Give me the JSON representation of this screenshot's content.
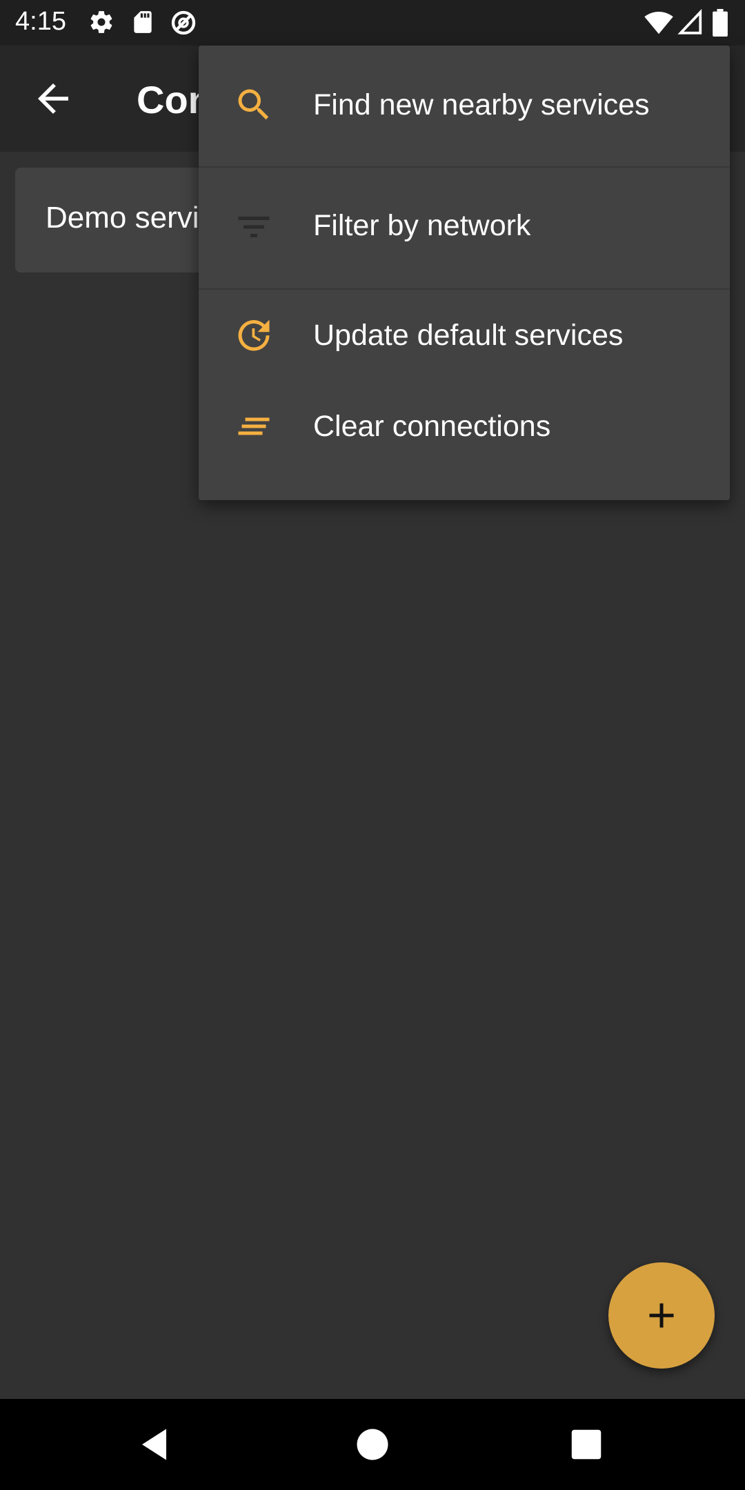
{
  "status_bar": {
    "time": "4:15",
    "icons": [
      "gear-icon",
      "sd-card-icon",
      "vpn-icon",
      "wifi-icon",
      "signal-icon",
      "battery-icon"
    ]
  },
  "app_bar": {
    "title": "Con",
    "back_icon": "arrow-back-icon"
  },
  "content": {
    "service_card_label": "Demo servi"
  },
  "overflow_menu": {
    "items": [
      {
        "label": "Find new nearby services",
        "icon": "search-icon",
        "icon_color": "#F5B041"
      },
      {
        "label": "Filter by network",
        "icon": "filter-icon",
        "icon_color": "#2b2b2b"
      },
      {
        "label": "Update default services",
        "icon": "update-clock-icon",
        "icon_color": "#F5B041"
      },
      {
        "label": "Clear connections",
        "icon": "clear-all-icon",
        "icon_color": "#F5B041"
      }
    ]
  },
  "fab": {
    "icon": "plus-icon",
    "color": "#D7A140"
  },
  "nav_bar": {
    "icons": [
      "nav-back-icon",
      "nav-home-icon",
      "nav-recents-icon"
    ]
  },
  "colors": {
    "background": "#313131",
    "app_bar": "#272727",
    "status_bar": "#1F1F1F",
    "menu": "#424242",
    "accent": "#F5B041"
  }
}
